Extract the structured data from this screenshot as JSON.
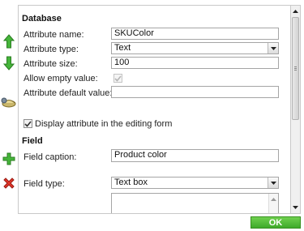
{
  "database": {
    "title": "Database",
    "attribute_name_label": "Attribute name:",
    "attribute_name_value": "SKUColor",
    "attribute_type_label": "Attribute type:",
    "attribute_type_value": "Text",
    "attribute_size_label": "Attribute size:",
    "attribute_size_value": "100",
    "allow_empty_label": "Allow empty value:",
    "allow_empty_checked": true,
    "default_value_label": "Attribute default value:",
    "default_value_value": "",
    "display_in_form_label": "Display attribute in the editing form",
    "display_in_form_checked": true
  },
  "field": {
    "title": "Field",
    "caption_label": "Field caption:",
    "caption_value": "Product color",
    "type_label": "Field type:",
    "type_value": "Text box"
  },
  "toolbar": {
    "icons": [
      "move-up-icon",
      "move-down-icon",
      "new-category-icon",
      "new-attribute-icon",
      "delete-icon"
    ]
  },
  "footer": {
    "ok_label": "OK"
  },
  "colors": {
    "ok_green": "#4cb834",
    "arrow_green": "#3aa12a",
    "delete_red": "#d8261c"
  }
}
